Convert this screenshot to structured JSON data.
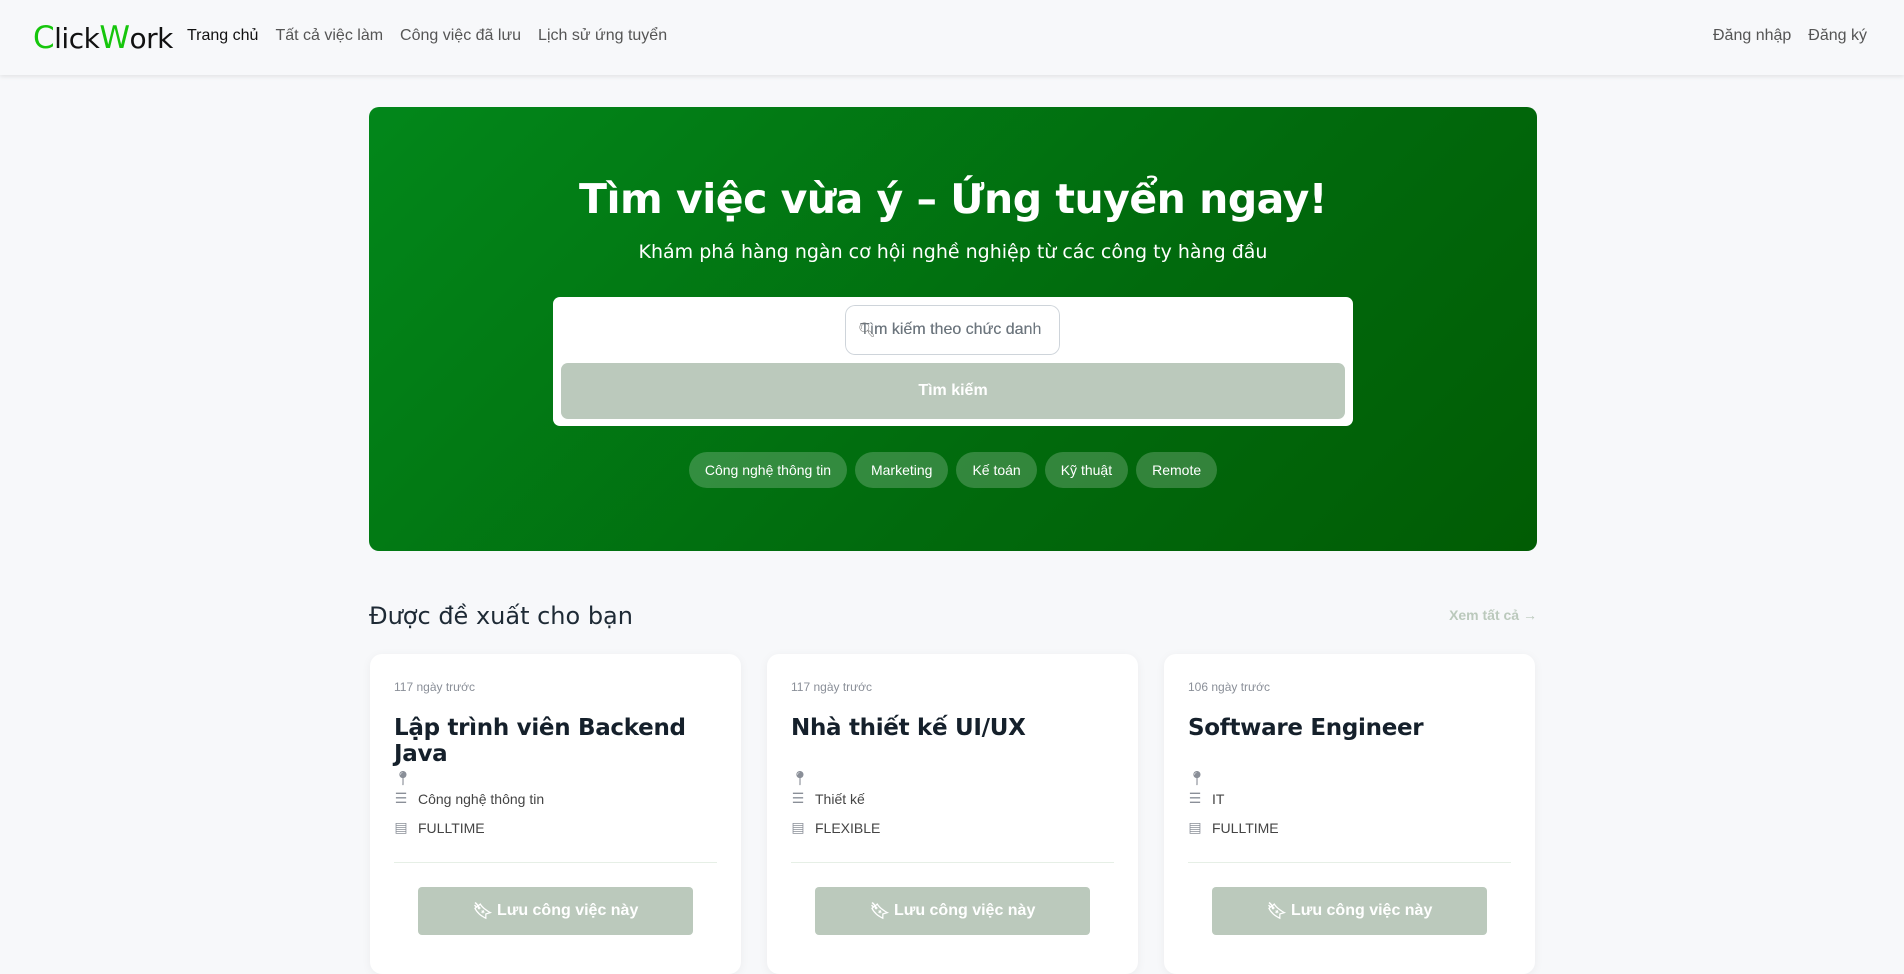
{
  "header": {
    "logo": {
      "c": "C",
      "lick": "lick",
      "w": "W",
      "ork": "ork"
    },
    "nav": [
      "Trang chủ",
      "Tất cả việc làm",
      "Công việc đã lưu",
      "Lịch sử ứng tuyển"
    ],
    "login": "Đăng nhập",
    "register": "Đăng ký"
  },
  "hero": {
    "title": "Tìm việc vừa ý – Ứng tuyển ngay!",
    "subtitle": "Khám phá hàng ngàn cơ hội nghề nghiệp từ các công ty hàng đầu",
    "search_placeholder": "Tìm kiếm theo chức danh",
    "search_visible": "m kiếm theo chức dar",
    "search_button": "Tìm kiếm",
    "chips": [
      "Công nghệ thông tin",
      "Marketing",
      "Kế toán",
      "Kỹ thuật",
      "Remote"
    ]
  },
  "section": {
    "title": "Được đề xuất cho bạn",
    "see_all": "Xem tất cả"
  },
  "jobs": [
    {
      "date": "117 ngày trước",
      "title": "Lập trình viên Backend Java",
      "location": "",
      "category": "Công nghệ thông tin",
      "type": "FULLTIME",
      "save": "Lưu công việc này"
    },
    {
      "date": "117 ngày trước",
      "title": "Nhà thiết kế UI/UX",
      "location": "",
      "category": "Thiết kế",
      "type": "FLEXIBLE",
      "save": "Lưu công việc này"
    },
    {
      "date": "106 ngày trước",
      "title": "Software Engineer",
      "location": "",
      "category": "IT",
      "type": "FULLTIME",
      "save": "Lưu công việc này"
    }
  ],
  "colors": {
    "brand": "#16c60c",
    "hero": "#02871a",
    "button": "#bbc9bc"
  }
}
